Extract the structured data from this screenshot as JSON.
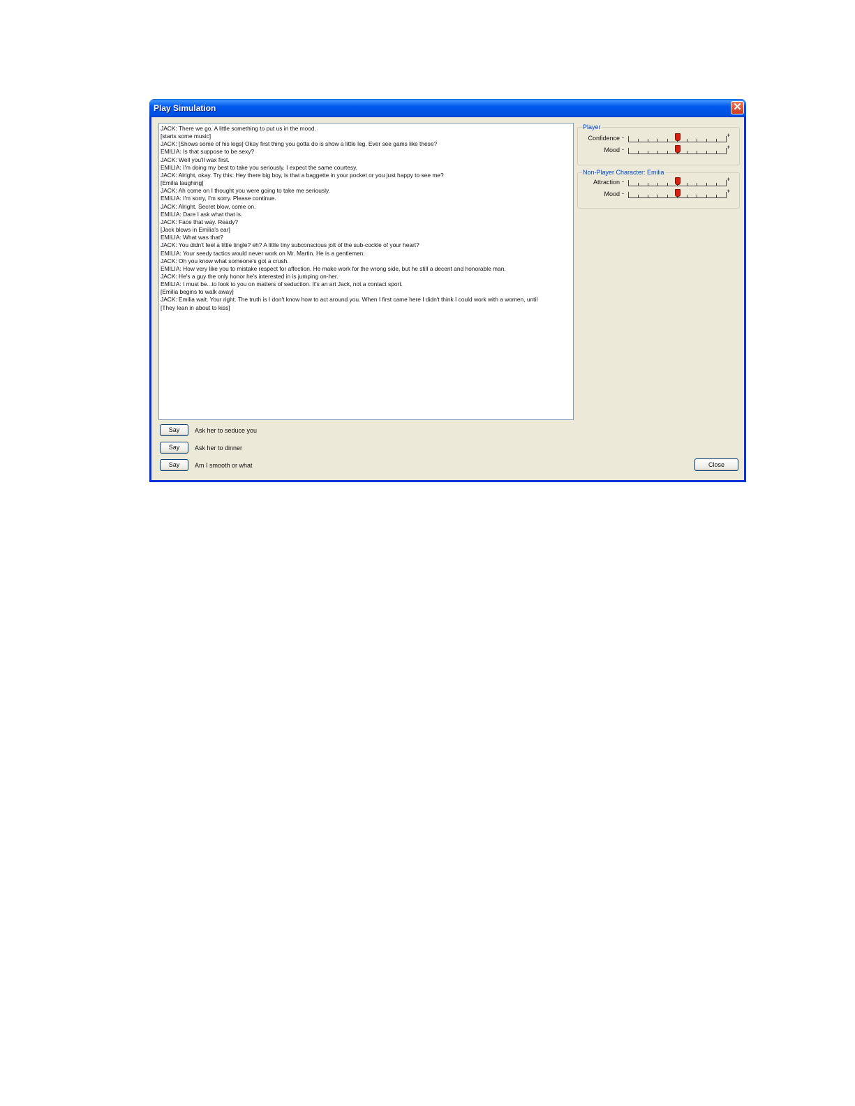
{
  "window": {
    "title": "Play Simulation",
    "close_glyph": "✕"
  },
  "transcript": {
    "lines": [
      "JACK:  There we go. A little something to put us in the mood.",
      "[starts some music]",
      "JACK:  [Shows some of his legs]   Okay first thing you gotta do is show a little leg. Ever see gams like these?",
      "EMILIA:  Is that suppose to be sexy?",
      "JACK:  Well you'll wax first.",
      "EMILIA:  I'm doing my best to take you seriously. I expect the same courtesy.",
      "JACK:  Alright, okay. Try this: Hey there big boy, is that a baggette in your pocket or you just happy to see me?",
      "[Emilia laughing]",
      "JACK:  Ah come on I thought you were going to take me seriously.",
      "EMILIA:  I'm sorry, I'm sorry. Please continue.",
      "JACK:  Alright. Secret blow, come on.",
      "EMILIA:  Dare I ask what that is.",
      "JACK:  Face that way. Ready?",
      "[Jack blows in Emilia's ear]",
      "EMILIA:  What was that?",
      "JACK:  You didn't feel a little tingle? eh? A little tiny subconscious jolt of the sub-cockle of your heart?",
      "EMILIA:  Your seedy tactics would never work on Mr. Martin. He is a gentlemen.",
      "JACK:  Oh you know what someone's got a crush.",
      "EMILIA:  How very like you to mistake respect for affection. He make work for the wrong side, but he still a decent and honorable man.",
      "JACK:  He's a guy the only honor he's interested in is jumping on-her.",
      "EMILIA:  I must be...to look to you on matters of seduction. It's an art Jack, not a contact sport.",
      "[Emilia begins to walk away]",
      "JACK:  Emilia wait. Your right. The truth is I don't know how to act around you. When I first came here I didn't think I could work with a women, until",
      "[They lean in about to kiss]"
    ]
  },
  "player": {
    "group_label": "Player",
    "confidence_label": "Confidence",
    "confidence_level": 0.5,
    "mood_label": "Mood",
    "mood_level": 0.5
  },
  "npc": {
    "group_label": "Non-Player Character: Emilia",
    "attraction_label": "Attraction",
    "attraction_level": 0.5,
    "mood_label": "Mood",
    "mood_level": 0.5
  },
  "slider_signs": {
    "minus": "-",
    "plus": "+"
  },
  "options": [
    {
      "button_label": "Say",
      "text": "Ask her to seduce you"
    },
    {
      "button_label": "Say",
      "text": "Ask her to dinner"
    },
    {
      "button_label": "Say",
      "text": "Am I smooth or what"
    }
  ],
  "footer": {
    "close_label": "Close"
  },
  "colors": {
    "title_bar": "#0058ee",
    "group_label": "#0046d5",
    "slider_thumb": "#d81f10"
  },
  "icons": {
    "window_close": "close-icon"
  }
}
